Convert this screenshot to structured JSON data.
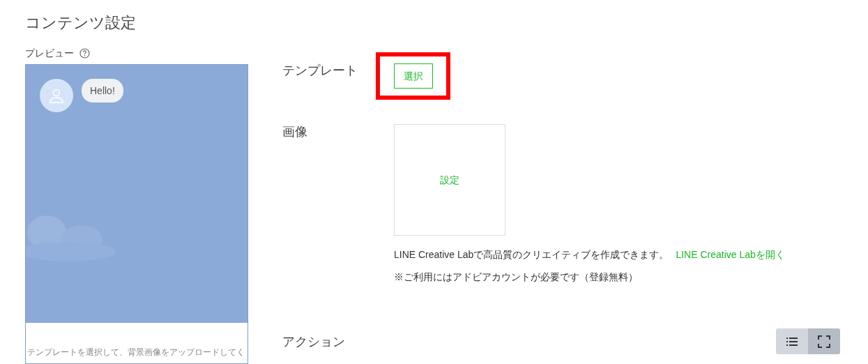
{
  "page_title": "コンテンツ設定",
  "preview": {
    "label": "プレビュー",
    "bubble": "Hello!",
    "caption": "テンプレートを選択して、背景画像をアップロードしてく"
  },
  "template": {
    "label": "テンプレート",
    "button": "選択",
    "highlighted": true
  },
  "image": {
    "label": "画像",
    "button": "設定",
    "note": "LINE Creative Labで高品質のクリエイティブを作成できます。",
    "link": "LINE Creative Labを開く",
    "notice": "※ご利用にはアドビアカウントが必要です（登録無料）"
  },
  "action": {
    "label": "アクション",
    "views": [
      {
        "kind": "list",
        "selected": false
      },
      {
        "kind": "full",
        "selected": true
      }
    ]
  }
}
